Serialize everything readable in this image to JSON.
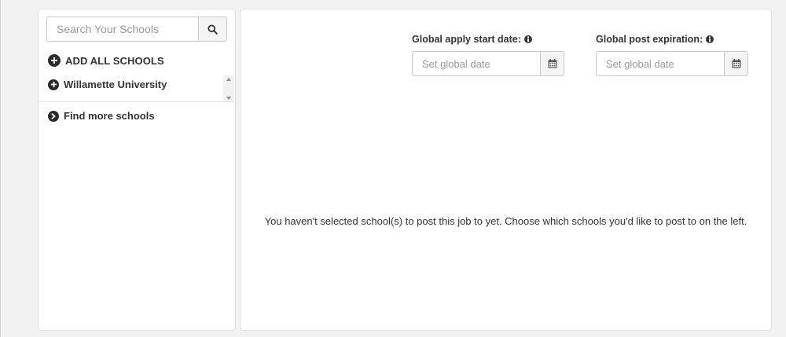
{
  "sidebar": {
    "search": {
      "placeholder": "Search Your Schools",
      "value": "",
      "button_icon": "search-icon"
    },
    "add_all_label": "ADD ALL SCHOOLS",
    "schools": [
      {
        "label": "Willamette University",
        "icon": "plus-circle-icon"
      }
    ],
    "find_more_label": "Find more schools"
  },
  "main": {
    "apply_start": {
      "label": "Global apply start date:",
      "placeholder": "Set global date",
      "value": "",
      "icon": "calendar-icon"
    },
    "post_expiration": {
      "label": "Global post expiration:",
      "placeholder": "Set global date",
      "value": "",
      "icon": "calendar-icon"
    },
    "empty_message": "You haven't selected school(s) to post this job to yet. Choose which schools you'd like to post to on the left."
  },
  "colors": {
    "page_background": "#f2f2f2",
    "panel_background": "#ffffff",
    "border": "#dedede",
    "icon_dark": "#2b2b2b"
  }
}
